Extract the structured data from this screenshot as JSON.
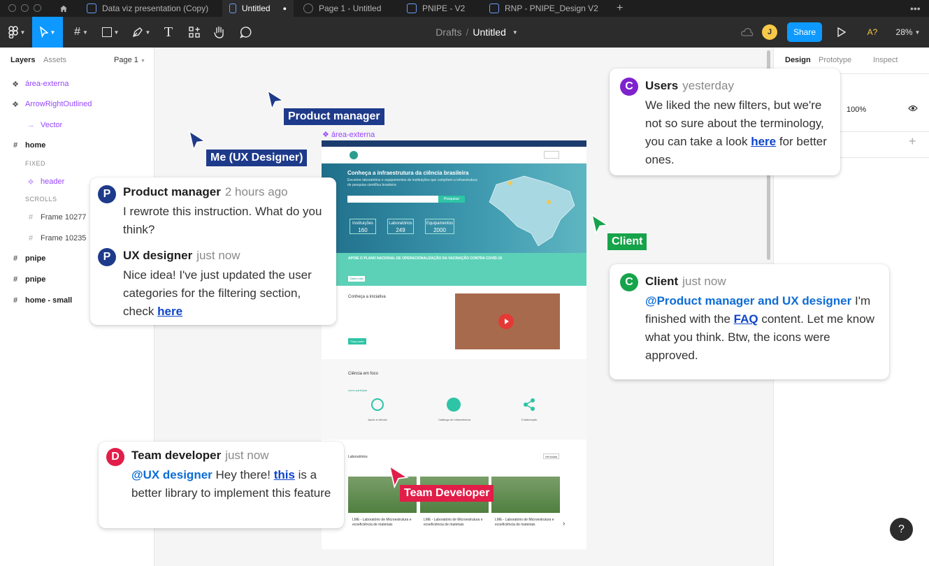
{
  "tabs": [
    "Data viz presentation (Copy)",
    "Untitled",
    "Page 1 - Untitled",
    "PNIPE - V2",
    "RNP - PNIPE_Design V2"
  ],
  "active_tab_dot": "●",
  "toolbar": {
    "breadcrumb_drafts": "Drafts",
    "breadcrumb_sep": "/",
    "file_name": "Untitled",
    "share": "Share",
    "avatar": "J",
    "zoom": "28%",
    "accessibility": "A?"
  },
  "left": {
    "tab_layers": "Layers",
    "tab_assets": "Assets",
    "page": "Page 1",
    "layers": [
      {
        "icon": "component",
        "name": "área-externa"
      },
      {
        "icon": "component",
        "name": "ArrowRightOutlined"
      },
      {
        "icon": "vector",
        "name": "Vector"
      },
      {
        "icon": "frame",
        "name": "home"
      },
      {
        "icon": "",
        "name": "FIXED"
      },
      {
        "icon": "component",
        "name": "header"
      },
      {
        "icon": "",
        "name": "SCROLLS"
      },
      {
        "icon": "frame",
        "name": "Frame 10277"
      },
      {
        "icon": "frame",
        "name": "Frame 10235"
      },
      {
        "icon": "frame",
        "name": "pnipe"
      },
      {
        "icon": "frame",
        "name": "pnipe"
      },
      {
        "icon": "frame",
        "name": "home - small"
      }
    ]
  },
  "right": {
    "tab_design": "Design",
    "tab_prototype": "Prototype",
    "tab_inspect": "Inspect",
    "opacity": "100%",
    "plus": "+"
  },
  "canvas": {
    "frame_label": "área-externa",
    "cursors": {
      "pm": "Product manager",
      "me": "Me (UX Designer)",
      "client": "Client",
      "dev": "Team Developer"
    },
    "colors": {
      "pm": "#1e3a8a",
      "me": "#1e3a8a",
      "client": "#16a34a",
      "dev": "#e11d48",
      "users_av": "#7e22ce",
      "dev_av": "#e11d48",
      "client_av": "#16a34a",
      "pm_av": "#1e3a8a"
    },
    "comments": {
      "users": {
        "initial": "C",
        "author": "Users",
        "time": "yesterday",
        "text": "We liked the new filters, but we're not so sure about the terminology, you can take a look",
        "link": "here",
        "text2": "for better ones."
      },
      "pm": {
        "initial": "P",
        "author": "Product manager",
        "time": "2 hours ago",
        "text": "I rewrote this instruction. What do you think?"
      },
      "ux": {
        "initial": "P",
        "author": "UX designer",
        "time": "just now",
        "text": "Nice idea! I've just updated the user categories for the filtering section, check",
        "link": "here"
      },
      "client": {
        "initial": "C",
        "author": "Client",
        "time": "just now",
        "mention": "@Product manager and UX designer",
        "text": "I'm finished with the",
        "link": "FAQ",
        "text2": "content. Let me know what you think. Btw, the icons were approved."
      },
      "dev": {
        "initial": "D",
        "author": "Team developer",
        "time": "just now",
        "mention": "@UX designer",
        "text": "Hey there!",
        "link": "this",
        "text2": "is a better library to implement this feature"
      }
    },
    "site": {
      "hero_title": "Conheça a infraestrutura da ciência brasileira",
      "hero_sub": "Encontre laboratórios e equipamentos de instituições que compõem a infraestrutura de pesquisa científica brasileira",
      "search_btn": "Pesquisar",
      "stats": [
        {
          "label": "Instituições",
          "value": "160"
        },
        {
          "label": "Laboratórios",
          "value": "249"
        },
        {
          "label": "Equipamentos",
          "value": "2000"
        }
      ],
      "banner": "APOIE O PLANO NACIONAL DE OPERACIONALIZAÇÃO DA VACINAÇÃO CONTRA COVID-19",
      "banner_btn": "Saiba mais",
      "intro_title": "Conheça a iniciativa",
      "intro_btn": "Faça parte",
      "focus_title": "Ciência em foco",
      "focus_link": "como participar",
      "focus_items": [
        "Apoio à ciência",
        "Catálogo de infraestrutura",
        "Colaboração"
      ],
      "labs_title": "Laboratórios",
      "labs_btn": "Ver todos",
      "lab_cards": [
        "LME - Laboratório de Microestrutura e ecoeficiência de materiais",
        "LME - Laboratório de Microestrutura e ecoeficiência de materiais",
        "LME - Laboratório de Microestrutura e ecoeficiência de materiais"
      ]
    }
  },
  "help": "?"
}
